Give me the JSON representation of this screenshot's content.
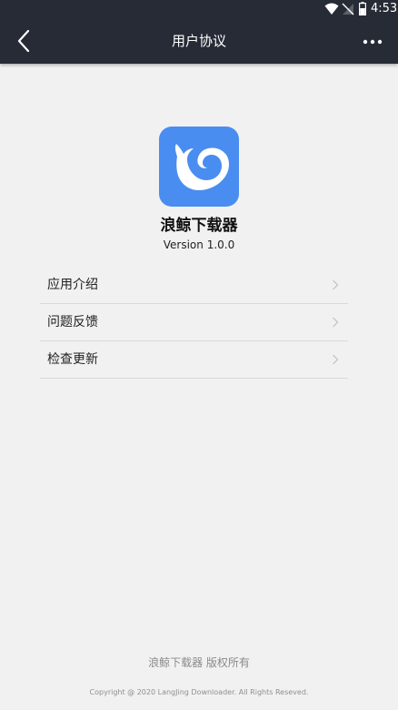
{
  "status_bar": {
    "time": "4:53",
    "wifi_icon": "wifi-icon",
    "signal_icon": "no-signal-icon",
    "battery_icon": "battery-icon"
  },
  "header": {
    "title": "用户协议",
    "back_icon": "back-arrow-icon",
    "more_icon": "more-dots-icon",
    "background_color": "#262b36"
  },
  "app": {
    "name": "浪鲸下载器",
    "version": "Version 1.0.0",
    "icon": "whale-logo-icon",
    "icon_color": "#4a8df0"
  },
  "menu": {
    "items": [
      {
        "label": "应用介绍"
      },
      {
        "label": "问题反馈"
      },
      {
        "label": "检查更新"
      }
    ],
    "chevron_icon": "chevron-right-icon"
  },
  "footer": {
    "rights": "浪鲸下载器 版权所有",
    "copyright": "Copyright @ 2020 LangJing Downloader. All Rights Reseved."
  }
}
